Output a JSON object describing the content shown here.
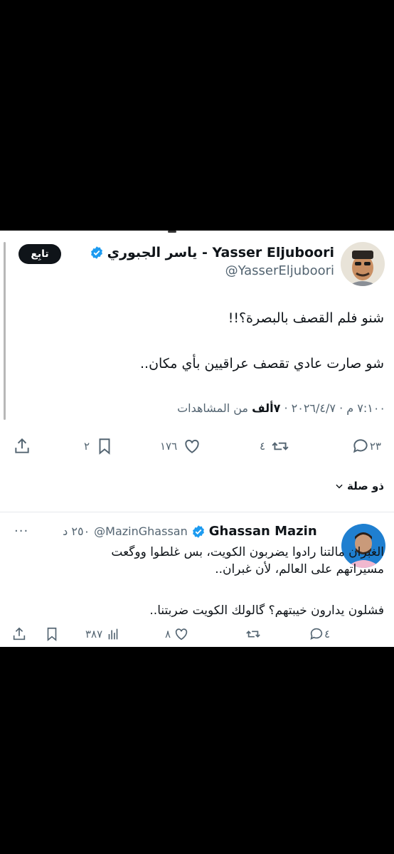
{
  "tweet": {
    "display_name": "Yasser Eljuboori - ياسر الجبوري",
    "handle": "@YasserEljuboori",
    "follow_label": "تابِع",
    "line1": "شنو فلم القصف بالبصرة؟!!",
    "line2": "شو صارت عادي تقصف عراقيين بأي مكان..",
    "timestamp": "٧:١٠٠ م · ٢٠٢٦/٤/٧ · ",
    "views_count": "٧ألف",
    "views_label": " من المشاهدات",
    "actions": {
      "replies": "٢٣",
      "retweets": "٤",
      "likes": "١٧٦",
      "bookmarks": "٢"
    }
  },
  "related_label": "ذو صلة",
  "reply": {
    "display_name": "Ghassan Mazin",
    "handle": "@MazinGhassan",
    "time": "٢٥٠ د",
    "dots": "···",
    "line1": "الغبران مالتنا رادوا يضربون الكويت، بس غلطوا ووگعت",
    "line2": "مسيراتهم على العالم، لأن غبران..",
    "line3": "فشلون يدارون خيبتهم؟ گالولك الكويت ضربتنا..",
    "actions": {
      "replies": "٤",
      "retweets": "",
      "likes": "٨",
      "views": "٣٨٧"
    }
  },
  "colors": {
    "verified": "#1d9bf0",
    "secondary_text": "#536471",
    "primary_text": "#0f1419"
  }
}
